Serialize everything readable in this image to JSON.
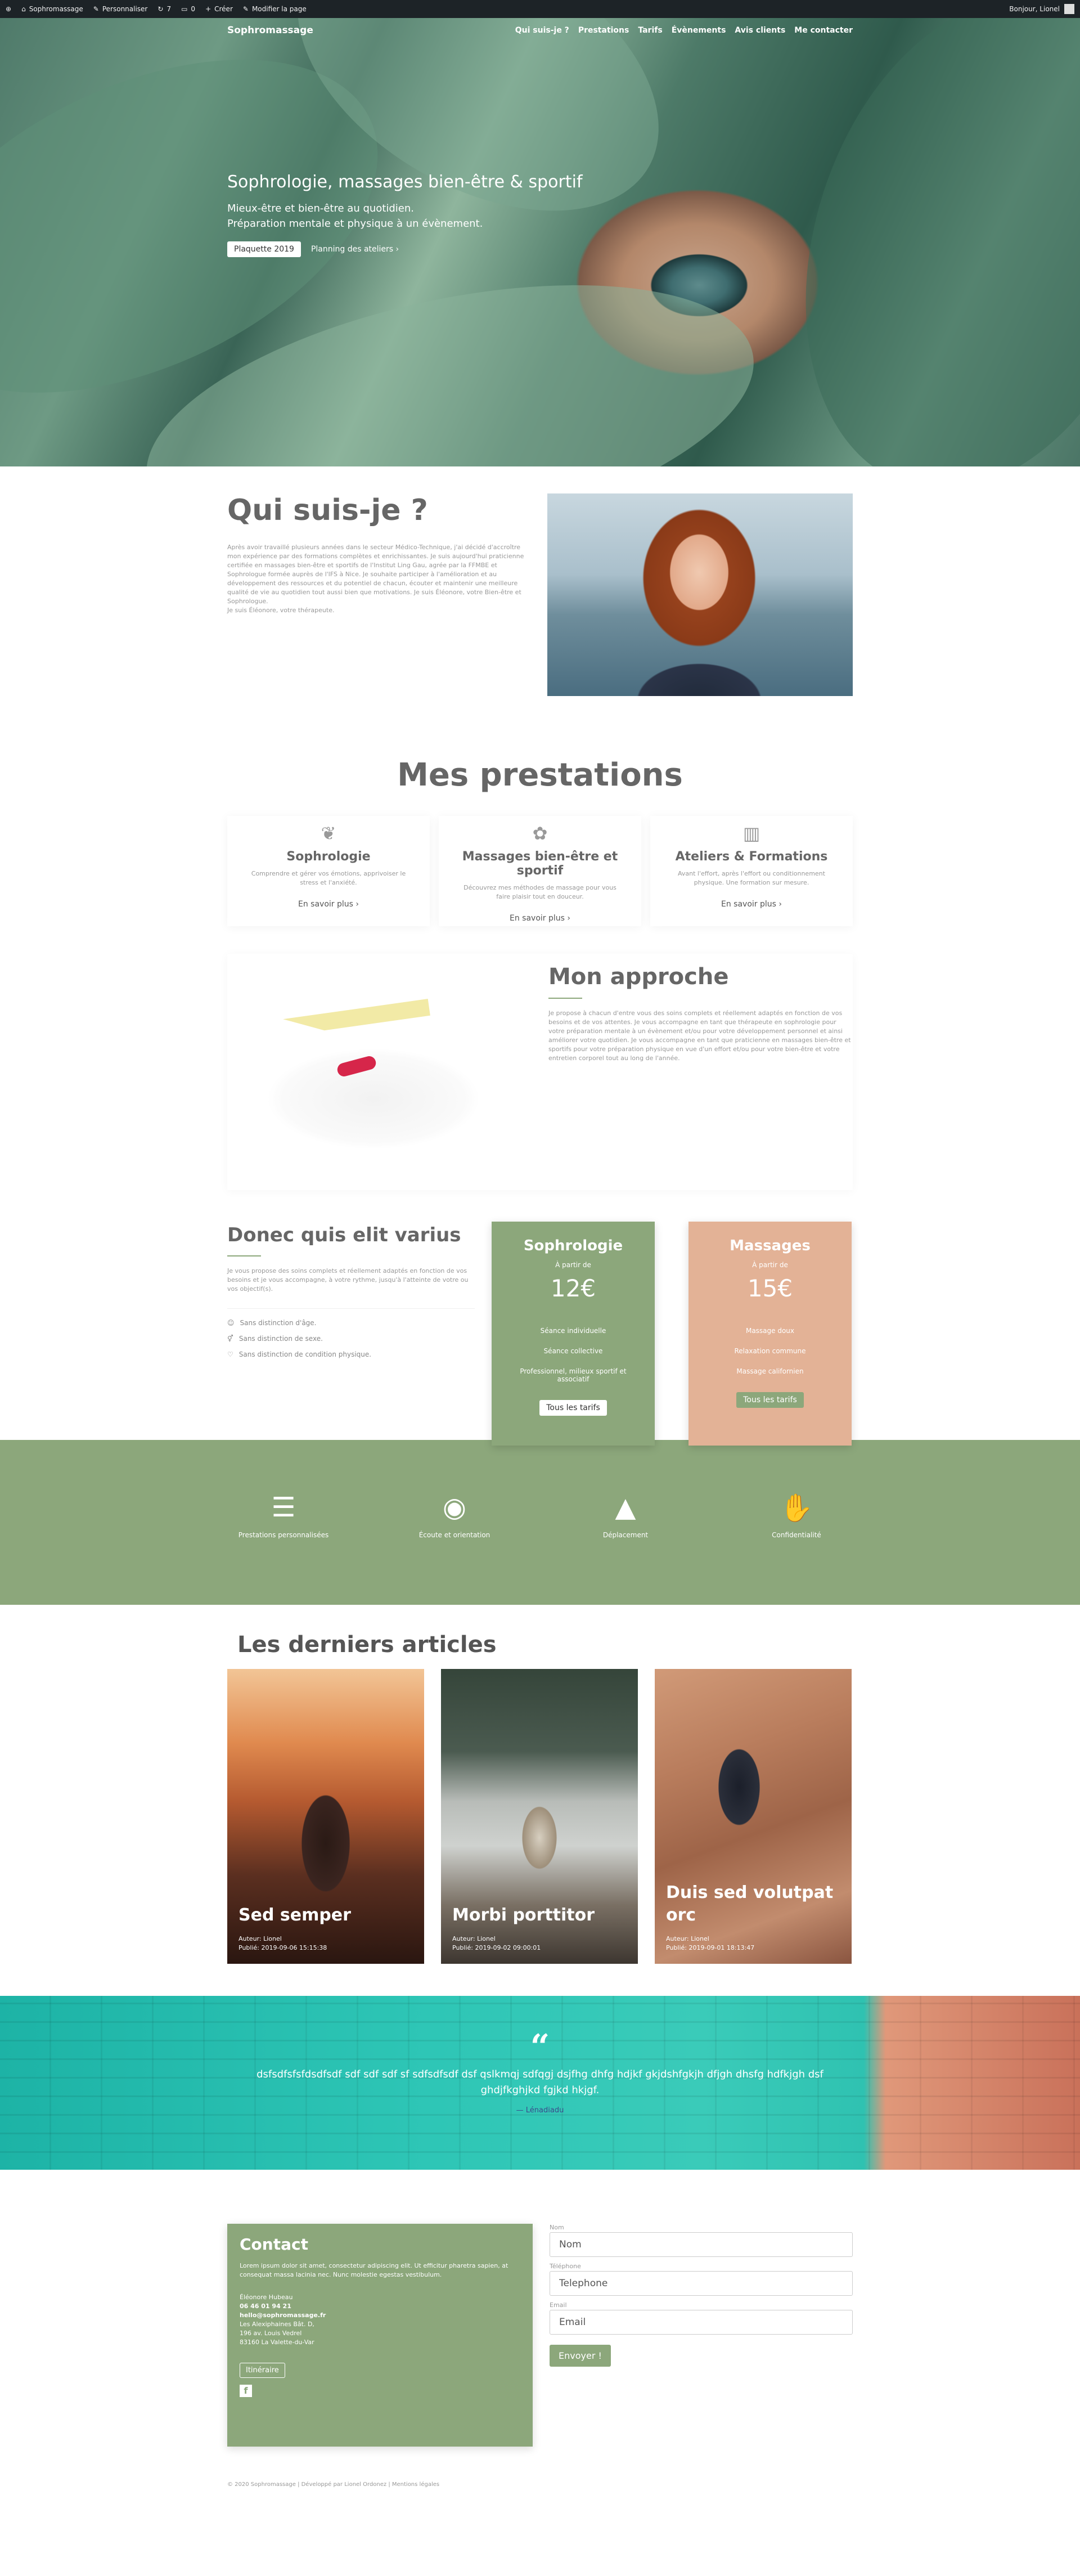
{
  "adminbar": {
    "site": "Sophromassage",
    "customize": "Personnaliser",
    "updates": "7",
    "comments": "0",
    "create": "Créer",
    "edit_page": "Modifier la page",
    "greeting": "Bonjour, Lionel"
  },
  "nav": {
    "logo": "Sophromassage",
    "items": [
      "Qui suis-je ?",
      "Prestations",
      "Tarifs",
      "Évènements",
      "Avis clients",
      "Me contacter"
    ]
  },
  "hero": {
    "title": "Sophrologie, massages bien-être & sportif",
    "line1": "Mieux-être et bien-être au quotidien.",
    "line2": "Préparation mentale et physique à un évènement.",
    "btn_primary": "Plaquette 2019",
    "btn_link": "Planning des ateliers"
  },
  "about": {
    "title": "Qui suis-je ?",
    "text": "Après avoir travaillé plusieurs années dans le secteur Médico-Technique, j'ai décidé d'accroître mon expérience par des formations complètes et enrichissantes. Je suis aujourd'hui praticienne certifiée en massages bien-être et sportifs de l'Institut Ling Gau, agrée par la FFMBE et Sophrologue formée auprès de l'IFS à Nice. Je souhaite participer à l'amélioration et au développement des ressources et du potentiel de chacun, écouter et maintenir une meilleure qualité de vie au quotidien tout aussi bien que motivations. Je suis Éléonore, votre Bien-être et Sophrologue.",
    "sign": "Je suis Éléonore, votre thérapeute."
  },
  "services": {
    "title": "Mes prestations",
    "more": "En savoir plus",
    "cards": [
      {
        "title": "Sophrologie",
        "text": "Comprendre et gérer vos émotions, apprivoiser le stress et l'anxiété."
      },
      {
        "title": "Massages bien-être et sportif",
        "text": "Découvrez mes méthodes de massage pour vous faire plaisir tout en douceur."
      },
      {
        "title": "Ateliers & Formations",
        "text": "Avant l'effort, après l'effort ou conditionnement physique. Une formation sur mesure."
      }
    ]
  },
  "approach": {
    "title": "Mon approche",
    "text": "Je propose à chacun d'entre vous des soins complets et réellement adaptés en fonction de vos besoins et de vos attentes. Je vous accompagne en tant que thérapeute en sophrologie pour votre préparation mentale à un évènement et/ou pour votre développement personnel et ainsi améliorer votre quotidien. Je vous accompagne en tant que praticienne en massages bien-être et sportifs pour votre préparation physique en vue d'un effort et/ou pour votre bien-être et votre entretien corporel tout au long de l'année."
  },
  "pricing": {
    "title": "Donec quis elit varius",
    "text": "Je vous propose des soins complets et réellement adaptés en fonction de vos besoins et je vous accompagne, à votre rythme, jusqu'à l'atteinte de votre ou vos objectif(s).",
    "features": [
      "Sans distinction d'âge.",
      "Sans distinction de sexe.",
      "Sans distinction de condition physique."
    ],
    "cards": [
      {
        "title": "Sophrologie",
        "from": "À partir de",
        "price": "12€",
        "items": [
          "Séance individuelle",
          "Séance collective",
          "Professionnel, milieux sportif et associatif"
        ],
        "btn": "Tous les tarifs"
      },
      {
        "title": "Massages",
        "from": "À partir de",
        "price": "15€",
        "items": [
          "Massage doux",
          "Relaxation commune",
          "Massage californien"
        ],
        "btn": "Tous les tarifs"
      }
    ]
  },
  "band": {
    "items": [
      "Prestations personnalisées",
      "Écoute et orientation",
      "Déplacement",
      "Confidentialité"
    ]
  },
  "articles": {
    "title": "Les derniers articles",
    "cards": [
      {
        "title": "Sed semper",
        "author": "Auteur: Lionel",
        "date": "Publié: 2019-09-06 15:15:38"
      },
      {
        "title": "Morbi porttitor",
        "author": "Auteur: Lionel",
        "date": "Publié: 2019-09-02 09:00:01"
      },
      {
        "title": "Duis sed volutpat orc",
        "author": "Auteur: Lionel",
        "date": "Publié: 2019-09-01 18:13:47"
      }
    ]
  },
  "quote": {
    "text": "dsfsdfsfsfdsdfsdf sdf sdf sdf sf sdfsdfsdf dsf qslkmqj sdfqgj dsjfhg dhfg hdjkf gkjdshfgkjh dfjgh dhsfg hdfkjgh dsf ghdjfkghjkd fgjkd hkjgf.",
    "author": "— Lénadiadu"
  },
  "contact": {
    "title": "Contact",
    "intro": "Lorem ipsum dolor sit amet, consectetur adipiscing elit. Ut efficitur pharetra sapien, at consequat massa lacinia nec. Nunc molestie egestas vestibulum.",
    "name": "Éléonore Hubeau",
    "phone": "06 46 01 94 21",
    "email": "hello@sophromassage.fr",
    "addr1": "Les Alexiphaines Bât. D,",
    "addr2": "196 av. Louis Vedrel",
    "addr3": "83160 La Valette-du-Var",
    "route_btn": "Itinéraire",
    "form": {
      "name_label": "Nom",
      "name_ph": "Nom",
      "phone_label": "Téléphone",
      "phone_ph": "Telephone",
      "email_label": "Email",
      "email_ph": "Email",
      "submit": "Envoyer !"
    }
  },
  "footer": {
    "text": "© 2020 Sophromassage | Développé par Lionel Ordonez | Mentions légales"
  }
}
